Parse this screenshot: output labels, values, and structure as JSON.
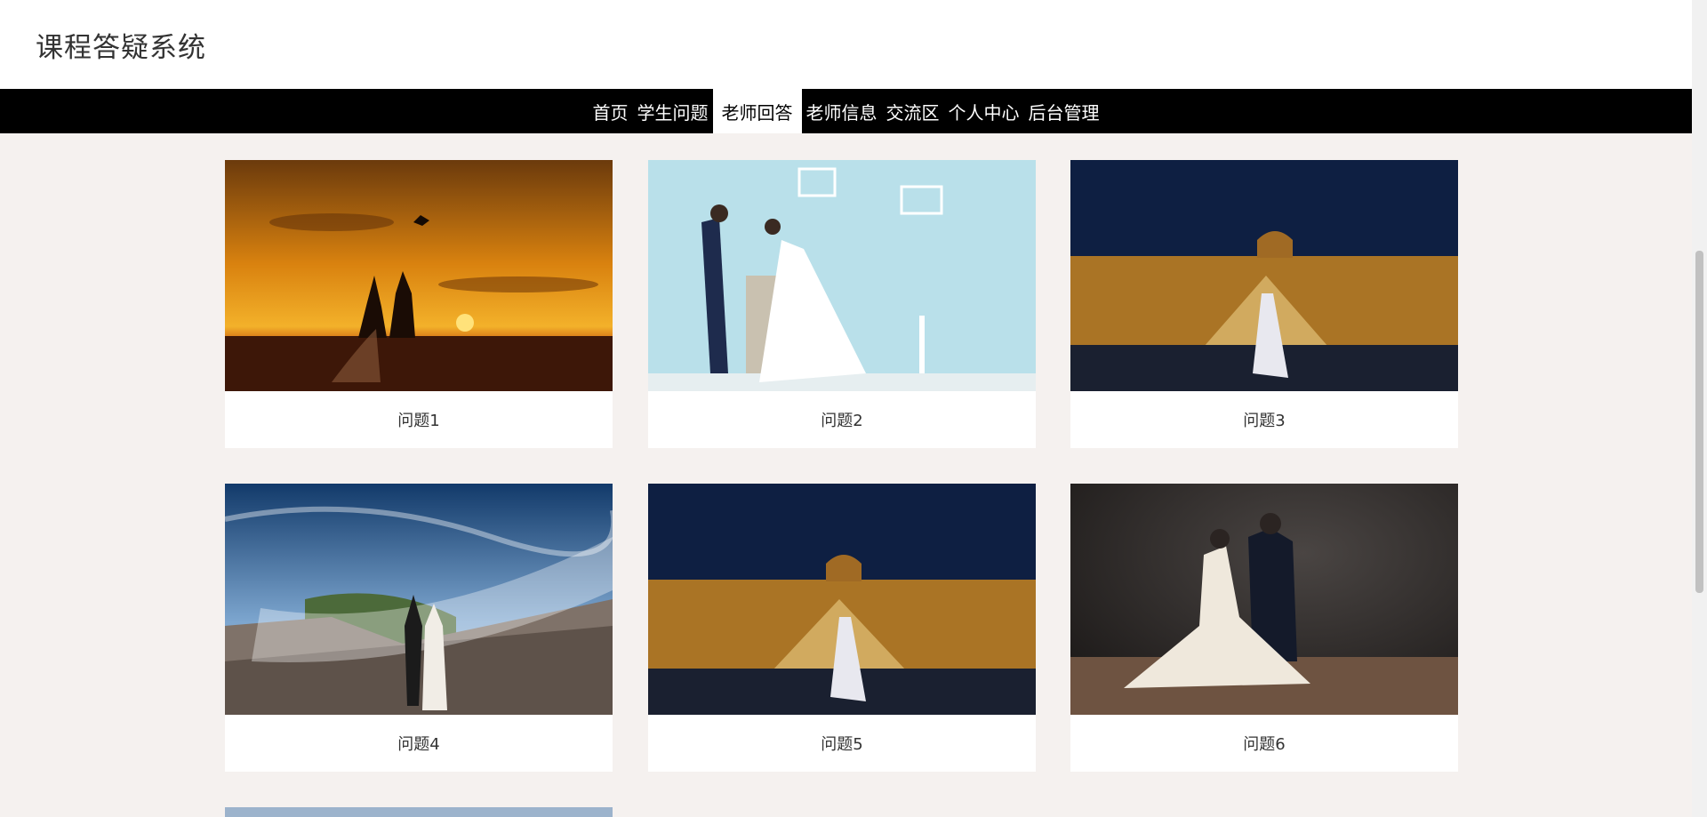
{
  "header": {
    "title": "课程答疑系统"
  },
  "nav": {
    "items": [
      {
        "label": "首页",
        "active": false
      },
      {
        "label": "学生问题",
        "active": false
      },
      {
        "label": "老师回答",
        "active": true
      },
      {
        "label": "老师信息",
        "active": false
      },
      {
        "label": "交流区",
        "active": false
      },
      {
        "label": "个人中心",
        "active": false
      },
      {
        "label": "后台管理",
        "active": false
      }
    ]
  },
  "cards": [
    {
      "label": "问题1",
      "image": "sunset-beach-couple-photo"
    },
    {
      "label": "问题2",
      "image": "studio-couple-blue-wall-photo"
    },
    {
      "label": "问题3",
      "image": "louvre-night-bride-photo"
    },
    {
      "label": "问题4",
      "image": "great-wall-couple-photo"
    },
    {
      "label": "问题5",
      "image": "louvre-night-bride-photo"
    },
    {
      "label": "问题6",
      "image": "dark-studio-couple-photo"
    }
  ]
}
